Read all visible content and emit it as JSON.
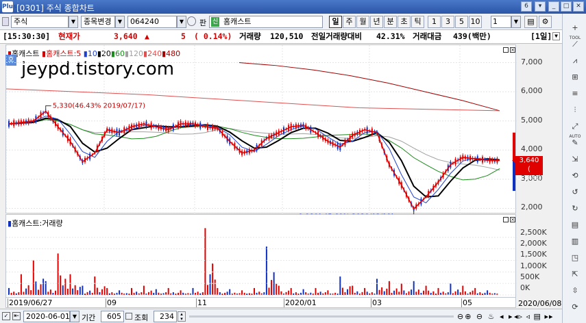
{
  "window": {
    "title": "[0301] 주식 종합차트",
    "logo": "Plus",
    "page_num": "6"
  },
  "toolbar": {
    "market": "주식",
    "change_label": "종목변경",
    "code": "064240",
    "pan": "판",
    "badge": "신",
    "name": "홈캐스트",
    "periods": [
      "일",
      "주",
      "월",
      "년",
      "분",
      "초",
      "틱"
    ],
    "active_period": "일",
    "nums": [
      "1",
      "3",
      "5",
      "10"
    ],
    "count": "1"
  },
  "info": {
    "time": "[15:30:30]",
    "label_price": "현재가",
    "price": "3,640",
    "arrow": "▲",
    "change": "5",
    "change_pct": "( 0.14%)",
    "label_vol": "거래량",
    "volume": "120,510",
    "label_prev": "전일거래량대비",
    "prev_ratio": "42.31%",
    "label_amt": "거래대금",
    "amount": "439(백만)",
    "unit": "[1일]"
  },
  "price_panel": {
    "legend_name": "홈캐스트",
    "legend_ma_prefix": "홈캐스트:5",
    "ma_labels": [
      "10",
      "20",
      "60",
      "120",
      "240",
      "480"
    ],
    "watermark": "jeypd.tistory.com",
    "side_tag": "호",
    "y_ticks": [
      "7,000",
      "6,000",
      "5,000",
      "4,000",
      "3,000",
      "2,000"
    ],
    "high_annotation": "5,330(46.43% 2019/07/17)",
    "low_annotation": "1,980(-45.60% 2020/03/19)",
    "price_tag": "3,640",
    "price_tag_pct": "( 0.14%)"
  },
  "volume_panel": {
    "legend": "홈캐스트:거래량",
    "y_ticks": [
      "2,500K",
      "2,000K",
      "1,500K",
      "1,000K",
      "500K",
      "0K"
    ]
  },
  "x_axis": {
    "labels": [
      "2019/06/27",
      "09",
      "11",
      "2020/01",
      "03",
      "05",
      "2020/06/08"
    ]
  },
  "bottom": {
    "date": "2020-06-01",
    "period_label": "기간",
    "period": "605",
    "query_label": "조회",
    "count": "234"
  },
  "rightbar": {
    "labels": [
      "TOOL",
      "",
      "",
      "AUTO"
    ]
  },
  "chart_data": {
    "type": "line",
    "title": "",
    "series": [
      {
        "name": "홈캐스트",
        "values": [
          4900,
          4950,
          5000,
          5330,
          4800,
          4300,
          3600,
          3900,
          4700,
          4600,
          4800,
          4900,
          4800,
          4700,
          4900,
          4900,
          4800,
          4750,
          4300,
          3900,
          4000,
          4400,
          4600,
          4800,
          4850,
          4600,
          4300,
          4100,
          4500,
          4700,
          4600,
          3500,
          2800,
          1980,
          2400,
          2900,
          3500,
          3750,
          3700,
          3650,
          3640
        ]
      },
      {
        "name": "240",
        "values": [
          6100,
          6000,
          5900,
          5750,
          5600,
          5450,
          5400,
          5350
        ]
      },
      {
        "name": "480",
        "values": [
          7000,
          6900,
          6750,
          6550,
          6300,
          6000,
          5700,
          5350
        ]
      }
    ],
    "ylim": [
      1800,
      7600
    ],
    "volume": [
      300,
      900,
      1500,
      600,
      1800,
      900,
      400,
      800,
      300,
      200,
      300,
      400,
      250,
      300,
      200,
      300,
      2900,
      300,
      250,
      200,
      300,
      2100,
      400,
      300,
      250,
      300,
      200,
      800,
      400,
      300,
      700,
      600,
      500,
      600,
      400,
      300,
      500,
      400,
      300,
      200,
      150
    ]
  }
}
